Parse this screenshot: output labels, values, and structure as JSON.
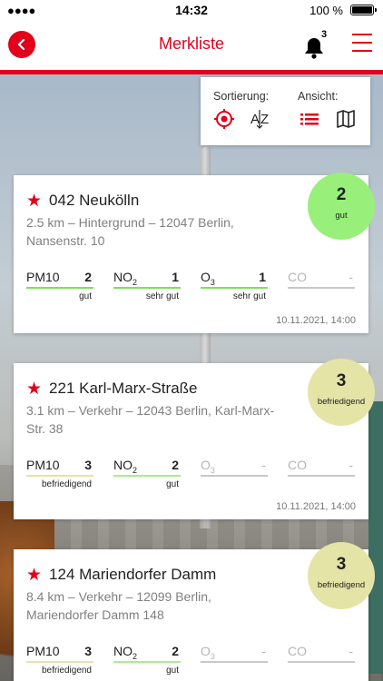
{
  "status_bar": {
    "time": "14:32",
    "battery": "100 %"
  },
  "header": {
    "title": "Merkliste",
    "notification_count": "3"
  },
  "sort_panel": {
    "sort_label": "Sortierung:",
    "view_label": "Ansicht:"
  },
  "stations": [
    {
      "name": "042 Neukölln",
      "address_line1": "2.5 km – Hintergrund – 12047 Berlin,",
      "address_line2": "Nansenstr. 10",
      "index": "2",
      "index_word": "gut",
      "badge_color": "#98f07a",
      "date": "10.11.2021, 14:00",
      "measurements": [
        {
          "name": "PM10",
          "sub": "",
          "value": "2",
          "word": "gut",
          "color": "#7ee05b"
        },
        {
          "name": "NO",
          "sub": "2",
          "value": "1",
          "word": "sehr gut",
          "color": "#7ee05b"
        },
        {
          "name": "O",
          "sub": "3",
          "value": "1",
          "word": "sehr gut",
          "color": "#7ee05b"
        },
        {
          "name": "CO",
          "sub": "",
          "value": "-",
          "word": "",
          "color": "#c8c8c8"
        }
      ]
    },
    {
      "name": "221 Karl-Marx-Straße",
      "address_line1": "3.1 km – Verkehr – 12043 Berlin, Karl-Marx-",
      "address_line2": "Str. 38",
      "index": "3",
      "index_word": "befriedigend",
      "badge_color": "#e4e4a6",
      "date": "10.11.2021, 14:00",
      "measurements": [
        {
          "name": "PM10",
          "sub": "",
          "value": "3",
          "word": "befriedigend",
          "color": "#e4e4a6"
        },
        {
          "name": "NO",
          "sub": "2",
          "value": "2",
          "word": "gut",
          "color": "#a6ef8c"
        },
        {
          "name": "O",
          "sub": "3",
          "value": "-",
          "word": "",
          "color": "#c8c8c8"
        },
        {
          "name": "CO",
          "sub": "",
          "value": "-",
          "word": "",
          "color": "#c8c8c8"
        }
      ]
    },
    {
      "name": "124 Mariendorfer Damm",
      "address_line1": "8.4 km – Verkehr – 12099 Berlin,",
      "address_line2": "Mariendorfer Damm 148",
      "index": "3",
      "index_word": "befriedigend",
      "badge_color": "#e4e4a6",
      "date": "",
      "measurements": [
        {
          "name": "PM10",
          "sub": "",
          "value": "3",
          "word": "befriedigend",
          "color": "#e4e4a6"
        },
        {
          "name": "NO",
          "sub": "2",
          "value": "2",
          "word": "gut",
          "color": "#a6ef8c"
        },
        {
          "name": "O",
          "sub": "3",
          "value": "-",
          "word": "",
          "color": "#c8c8c8"
        },
        {
          "name": "CO",
          "sub": "",
          "value": "-",
          "word": "",
          "color": "#c8c8c8"
        }
      ]
    }
  ]
}
